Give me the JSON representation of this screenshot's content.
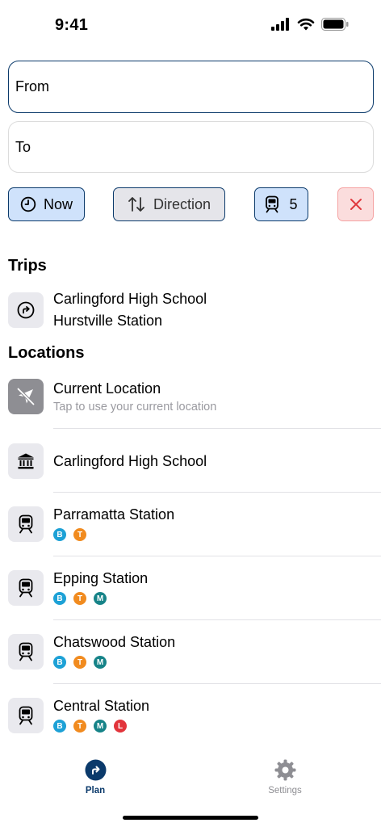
{
  "status": {
    "time": "9:41"
  },
  "search": {
    "from": "From",
    "to": "To"
  },
  "filters": {
    "now_label": "Now",
    "direction_label": "Direction",
    "mode_count": "5"
  },
  "trips": {
    "title": "Trips",
    "items": [
      {
        "origin": "Carlingford High School",
        "destination": "Hurstville Station",
        "icon": "directions-icon"
      }
    ]
  },
  "locations": {
    "title": "Locations",
    "current": {
      "title": "Current Location",
      "subtitle": "Tap to use your current location",
      "icon": "location-off-icon"
    },
    "items": [
      {
        "name": "Carlingford High School",
        "icon": "institution-icon",
        "badges": []
      },
      {
        "name": "Parramatta Station",
        "icon": "train-icon",
        "badges": [
          "B",
          "T"
        ]
      },
      {
        "name": "Epping Station",
        "icon": "train-icon",
        "badges": [
          "B",
          "T",
          "M"
        ]
      },
      {
        "name": "Chatswood Station",
        "icon": "train-icon",
        "badges": [
          "B",
          "T",
          "M"
        ]
      },
      {
        "name": "Central Station",
        "icon": "train-icon",
        "badges": [
          "B",
          "T",
          "M",
          "L"
        ]
      }
    ]
  },
  "badge_colors": {
    "B": "#1da1d6",
    "T": "#f18b1f",
    "M": "#168388",
    "L": "#e2343b"
  },
  "tabs": [
    {
      "label": "Plan",
      "icon": "directions-icon",
      "active": true
    },
    {
      "label": "Settings",
      "icon": "gear-icon",
      "active": false
    }
  ],
  "colors": {
    "accent": "#0b3a6b",
    "inactive": "#8e8e93"
  }
}
